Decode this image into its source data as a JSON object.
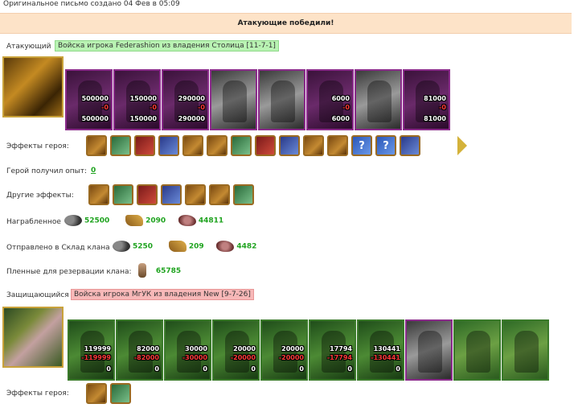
{
  "header": {
    "origin": "Оригинальное письмо создано 04 Фев в 05:09",
    "banner": "Атакующие победили!"
  },
  "attacker": {
    "label": "Атакующий",
    "tag": "Войска игрока Federashion из владения Столица [11-7-1]",
    "units": [
      {
        "style": "purple",
        "top": "500000",
        "mid": "-0",
        "bottom": "500000"
      },
      {
        "style": "purple",
        "top": "150000",
        "mid": "-0",
        "bottom": "150000"
      },
      {
        "style": "purple",
        "top": "290000",
        "mid": "-0",
        "bottom": "290000"
      },
      {
        "style": "gray",
        "top": "",
        "mid": "",
        "bottom": ""
      },
      {
        "style": "gray",
        "top": "",
        "mid": "",
        "bottom": ""
      },
      {
        "style": "purple",
        "top": "6000",
        "mid": "-0",
        "bottom": "6000"
      },
      {
        "style": "gray",
        "top": "",
        "mid": "",
        "bottom": ""
      },
      {
        "style": "purple",
        "top": "81000",
        "mid": "-0",
        "bottom": "81000"
      }
    ],
    "hero_effects_label": "Эффекты героя:",
    "hero_effects": [
      "sword-icon",
      "bow-icon",
      "fist-icon",
      "chest-icon",
      "dice-icon",
      "shield-icon",
      "scroll-icon",
      "bag-icon",
      "crystal-icon",
      "box-icon",
      "banner-icon",
      "question-icon",
      "question-icon",
      "book-icon"
    ],
    "exp_label": "Герой получил опыт:",
    "exp_value": "0",
    "other_effects_label": "Другие эффекты:",
    "other_effects": [
      "sword-icon",
      "sword-icon",
      "sword-icon",
      "sword-icon",
      "gold-bag-icon",
      "sword-icon",
      "sword-icon"
    ],
    "loot_label": "Награбленное",
    "loot": {
      "ore": "52500",
      "wood": "2090",
      "stone": "44811"
    },
    "sent_label": "Отправлено в Склад клана",
    "sent": {
      "ore": "5250",
      "wood": "209",
      "stone": "4482"
    },
    "prisoners_label": "Пленные для резервации клана:",
    "prisoners": "65785"
  },
  "defender": {
    "label": "Защищающийся",
    "tag": "Войска игрока МгУК из владения New [9-7-26]",
    "units": [
      {
        "style": "green",
        "top": "119999",
        "mid": "-119999",
        "bottom": "0"
      },
      {
        "style": "green",
        "top": "82000",
        "mid": "-82000",
        "bottom": "0"
      },
      {
        "style": "green",
        "top": "30000",
        "mid": "-30000",
        "bottom": "0"
      },
      {
        "style": "green",
        "top": "20000",
        "mid": "-20000",
        "bottom": "0"
      },
      {
        "style": "green",
        "top": "20000",
        "mid": "-20000",
        "bottom": "0"
      },
      {
        "style": "green",
        "top": "17794",
        "mid": "-17794",
        "bottom": "0"
      },
      {
        "style": "green",
        "top": "130441",
        "mid": "-130441",
        "bottom": "0"
      },
      {
        "style": "gray",
        "top": "",
        "mid": "",
        "bottom": ""
      },
      {
        "style": "tree",
        "top": "",
        "mid": "",
        "bottom": ""
      },
      {
        "style": "tree",
        "top": "",
        "mid": "",
        "bottom": ""
      }
    ],
    "hero_effects_label": "Эффекты героя:",
    "hero_effects": [
      "armor-icon",
      "ring-icon"
    ]
  },
  "colors": {
    "banner": "#fde3c8",
    "green_value": "#1fa31f",
    "attacker_tag": "#b9f3b3",
    "defender_tag": "#f7b8b8"
  }
}
